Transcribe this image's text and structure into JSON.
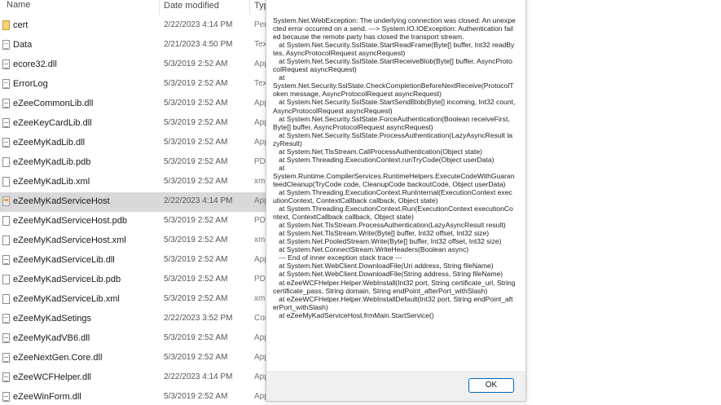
{
  "explorer": {
    "columns": {
      "name": "Name",
      "date": "Date modified",
      "type": "Typ"
    },
    "files": [
      {
        "name": "cert",
        "date": "2/22/2023 4:14 PM",
        "type": "Per",
        "icon": "certificate-icon"
      },
      {
        "name": "Data",
        "date": "2/21/2023 4:50 PM",
        "type": "Tex",
        "icon": "text-file-icon"
      },
      {
        "name": "ecore32.dll",
        "date": "5/3/2019 2:52 AM",
        "type": "App",
        "icon": "dll-file-icon"
      },
      {
        "name": "ErrorLog",
        "date": "5/3/2019 2:52 AM",
        "type": "Tex",
        "icon": "text-file-icon"
      },
      {
        "name": "eZeeCommonLib.dll",
        "date": "5/3/2019 2:52 AM",
        "type": "App",
        "icon": "dll-file-icon"
      },
      {
        "name": "eZeeKeyCardLib.dll",
        "date": "5/3/2019 2:52 AM",
        "type": "App",
        "icon": "dll-file-icon"
      },
      {
        "name": "eZeeMyKadLib.dll",
        "date": "5/3/2019 2:52 AM",
        "type": "App",
        "icon": "dll-file-icon"
      },
      {
        "name": "eZeeMyKadLib.pdb",
        "date": "5/3/2019 2:52 AM",
        "type": "PDI",
        "icon": "file-icon"
      },
      {
        "name": "eZeeMyKadLib.xml",
        "date": "5/3/2019 2:52 AM",
        "type": "xml",
        "icon": "file-icon"
      },
      {
        "name": "eZeeMyKadServiceHost",
        "date": "2/22/2023 4:14 PM",
        "type": "App",
        "icon": "application-icon",
        "selected": true
      },
      {
        "name": "eZeeMyKadServiceHost.pdb",
        "date": "5/3/2019 2:52 AM",
        "type": "PDI",
        "icon": "file-icon"
      },
      {
        "name": "eZeeMyKadServiceHost.xml",
        "date": "5/3/2019 2:52 AM",
        "type": "xm",
        "icon": "file-icon"
      },
      {
        "name": "eZeeMyKadServiceLib.dll",
        "date": "5/3/2019 2:52 AM",
        "type": "App",
        "icon": "dll-file-icon"
      },
      {
        "name": "eZeeMyKadServiceLib.pdb",
        "date": "5/3/2019 2:52 AM",
        "type": "PDI",
        "icon": "file-icon"
      },
      {
        "name": "eZeeMyKadServiceLib.xml",
        "date": "5/3/2019 2:52 AM",
        "type": "xml",
        "icon": "file-icon"
      },
      {
        "name": "eZeeMyKadSetings",
        "date": "2/22/2023 3:52 PM",
        "type": "Cor",
        "icon": "config-file-icon"
      },
      {
        "name": "eZeeMyKadVB6.dll",
        "date": "5/3/2019 2:52 AM",
        "type": "App",
        "icon": "dll-file-icon"
      },
      {
        "name": "eZeeNextGen.Core.dll",
        "date": "5/3/2019 2:52 AM",
        "type": "App",
        "icon": "dll-file-icon"
      },
      {
        "name": "eZeeWCFHelper.dll",
        "date": "2/22/2023 4:14 PM",
        "type": "App",
        "icon": "dll-file-icon"
      },
      {
        "name": "eZeeWinForm.dll",
        "date": "5/3/2019 2:52 AM",
        "type": "App",
        "icon": "dll-file-icon"
      }
    ]
  },
  "dialog": {
    "message": "System.Net.WebException: The underlying connection was closed: An unexpected error occurred on a send. ---> System.IO.IOException: Authentication failed because the remote party has closed the transport stream.\n   at System.Net.Security.SslState.StartReadFrame(Byte[] buffer, Int32 readBytes, AsyncProtocolRequest asyncRequest)\n   at System.Net.Security.SslState.StartReceiveBlob(Byte[] buffer, AsyncProtocolRequest asyncRequest)\n   at\nSystem.Net.Security.SslState.CheckCompletionBeforeNextReceive(ProtocolToken message, AsyncProtocolRequest asyncRequest)\n   at System.Net.Security.SslState.StartSendBlob(Byte[] incoming, Int32 count, AsyncProtocolRequest asyncRequest)\n   at System.Net.Security.SslState.ForceAuthentication(Boolean receiveFirst, Byte[] buffer, AsyncProtocolRequest asyncRequest)\n   at System.Net.Security.SslState.ProcessAuthentication(LazyAsyncResult lazyResult)\n   at System.Net.TlsStream.CallProcessAuthentication(Object state)\n   at System.Threading.ExecutionContext.runTryCode(Object userData)\n   at\nSystem.Runtime.CompilerServices.RuntimeHelpers.ExecuteCodeWithGuaranteedCleanup(TryCode code, CleanupCode backoutCode, Object userData)\n   at System.Threading.ExecutionContext.RunInternal(ExecutionContext executionContext, ContextCallback callback, Object state)\n   at System.Threading.ExecutionContext.Run(ExecutionContext executionContext, ContextCallback callback, Object state)\n   at System.Net.TlsStream.ProcessAuthentication(LazyAsyncResult result)\n   at System.Net.TlsStream.Write(Byte[] buffer, Int32 offset, Int32 size)\n   at System.Net.PooledStream.Write(Byte[] buffer, Int32 offset, Int32 size)\n   at System.Net.ConnectStream.WriteHeaders(Boolean async)\n   --- End of inner exception stack trace ---\n   at System.Net.WebClient.DownloadFile(Uri address, String fileName)\n   at System.Net.WebClient.DownloadFile(String address, String fileName)\n   at eZeeWCFHelper.Helper.WebInstall(Int32 port, String certificate_url, String certificate_pass, String domain, String endPoint_afterPort_withSlash)\n   at eZeeWCFHelper.Helper.WebInstallDefault(Int32 port, String endPoint_afterPort_withSlash)\n   at eZeeMyKadServiceHost.frmMain.StartService()",
    "ok_label": "OK"
  }
}
